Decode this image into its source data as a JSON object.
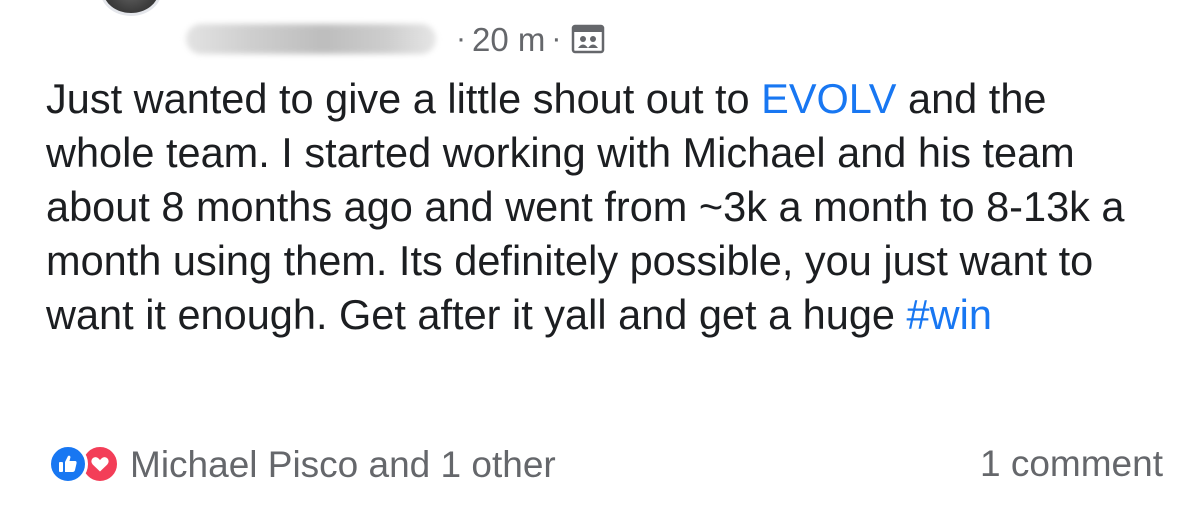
{
  "post": {
    "meta": {
      "separator": "·",
      "time": "20 m",
      "audience_icon": "group-audience-icon"
    },
    "text": {
      "part1": "Just wanted to give a little shout out to ",
      "mention": "EVOLV",
      "part2": " and the whole team. I started working with Michael and his team about 8 months ago and went from ~3k a month to 8-13k a month using them. Its definitely possible, you just want to want it enough. Get after it yall and get a huge ",
      "hashtag": "#win"
    },
    "footer": {
      "reactions_icons": [
        "like-icon",
        "love-icon"
      ],
      "reactions_label": "Michael Pisco and 1 other",
      "comments_label": "1 comment"
    },
    "colors": {
      "link": "#1877f2",
      "like": "#1877f2",
      "love": "#f33e58",
      "muted": "#65676b"
    }
  }
}
